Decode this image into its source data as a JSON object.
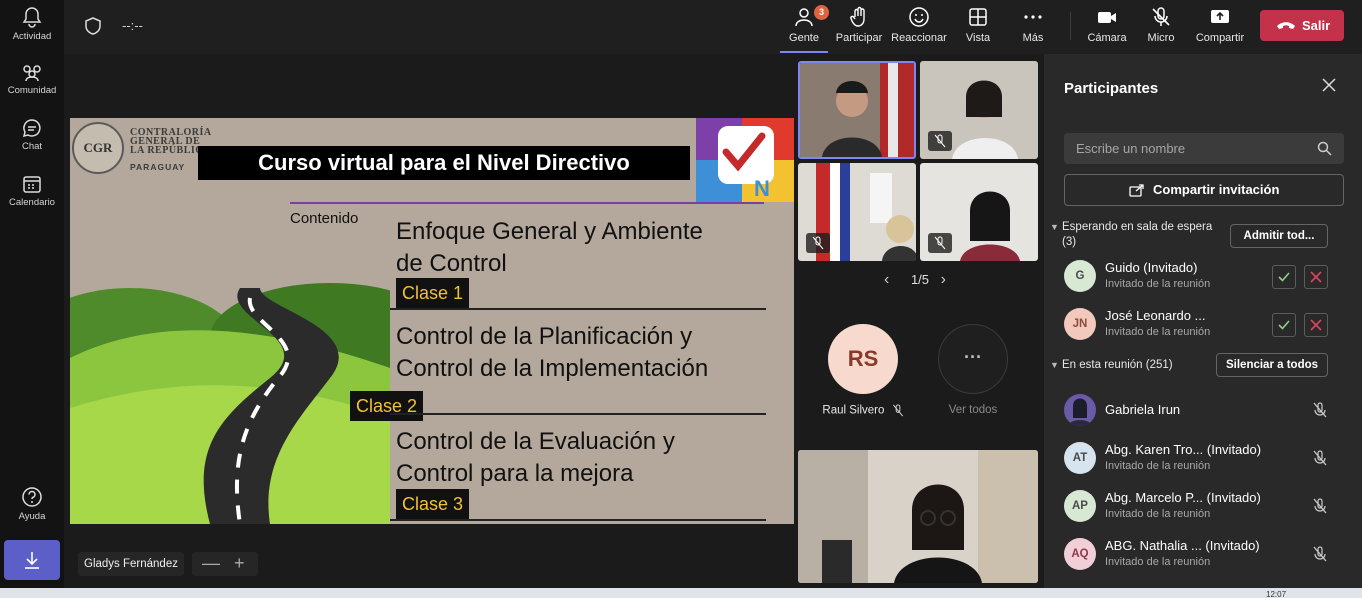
{
  "rail": {
    "items": [
      {
        "label": "Actividad",
        "icon": "bell-icon"
      },
      {
        "label": "Comunidad",
        "icon": "community-icon"
      },
      {
        "label": "Chat",
        "icon": "chat-icon"
      },
      {
        "label": "Calendario",
        "icon": "calendar-icon"
      },
      {
        "label": "Ayuda",
        "icon": "help-icon"
      }
    ]
  },
  "topbar": {
    "timer": "--:--",
    "people": {
      "label": "Gente",
      "badge": "3"
    },
    "participate_label": "Participar",
    "react_label": "Reaccionar",
    "view_label": "Vista",
    "more_label": "Más",
    "camera_label": "Cámara",
    "mic_label": "Micro",
    "share_label": "Compartir",
    "leave_label": "Salir"
  },
  "slide": {
    "org_lines": [
      "CONTRALORÍA",
      "GENERAL DE",
      "LA REPÚBLICA"
    ],
    "org_country": "PARAGUAY",
    "logo_text": "CGR",
    "title": "Curso virtual para el Nivel Directivo",
    "contents_label": "Contenido",
    "items": [
      {
        "line1": "Enfoque General y Ambiente",
        "line2": "de Control",
        "class": "Clase 1"
      },
      {
        "line1": "Control de la Planificación y",
        "line2": "Control de la Implementación",
        "class": "Clase 2"
      },
      {
        "line1": "Control de la Evaluación y",
        "line2": "Control para la mejora",
        "class": "Clase 3"
      }
    ]
  },
  "stage": {
    "presenter_name": "Gladys Fernández",
    "zoom_out": "—",
    "zoom_in": "+"
  },
  "grid": {
    "pager": "1/5",
    "avatar_initials": "RS",
    "avatar_name": "Raul Silvero",
    "see_all_label": "Ver todos"
  },
  "panel": {
    "title": "Participantes",
    "search_placeholder": "Escribe un nombre",
    "share_invite_label": "Compartir invitación",
    "lobby_header": "Esperando en sala de espera",
    "lobby_count": "(3)",
    "admit_all_label": "Admitir tod...",
    "lobby": [
      {
        "initials": "G",
        "name": "Guido (Invitado)",
        "sub": "Invitado de la reunión",
        "color": "#d7e8d3"
      },
      {
        "initials": "JN",
        "name": "José Leonardo ... ",
        "sub": "Invitado de la reunión",
        "color": "#f4c9bd"
      }
    ],
    "meeting_header": "En esta reunión (251)",
    "mute_all_label": "Silenciar a todos",
    "members": [
      {
        "initials": "",
        "name": "Gabriela Irun",
        "sub": "",
        "color": "#6b5aa8"
      },
      {
        "initials": "AT",
        "name": "Abg. Karen Tro... (Invitado)",
        "sub": "Invitado de la reunión",
        "color": "#d6e4ef"
      },
      {
        "initials": "AP",
        "name": "Abg. Marcelo P... (Invitado)",
        "sub": "Invitado de la reunión",
        "color": "#d7e8d3"
      },
      {
        "initials": "AQ",
        "name": "ABG. Nathalia ...  (Invitado)",
        "sub": "Invitado de la reunión",
        "color": "#f2cfd6"
      }
    ]
  },
  "taskbar": {
    "time": "12:07"
  }
}
